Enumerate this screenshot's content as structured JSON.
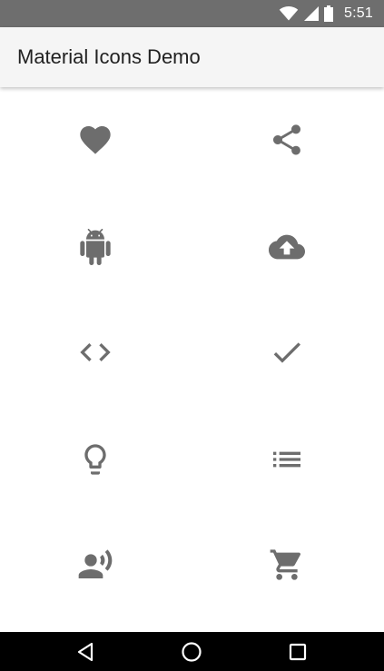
{
  "status_bar": {
    "time": "5:51",
    "icons": [
      "wifi-icon",
      "signal-icon",
      "battery-icon"
    ],
    "background": "#6e6e6e"
  },
  "app_bar": {
    "title": "Material Icons Demo",
    "background": "#f5f5f5"
  },
  "icons": [
    "favorite-icon",
    "share-icon",
    "android-icon",
    "cloud-upload-icon",
    "code-icon",
    "check-icon",
    "lightbulb-icon",
    "list-icon",
    "record-voice-icon",
    "shopping-cart-icon"
  ],
  "icon_color": "#6d6d6d",
  "nav_bar": {
    "buttons": [
      "back-icon",
      "home-icon",
      "recent-apps-icon"
    ],
    "background": "#000000"
  }
}
